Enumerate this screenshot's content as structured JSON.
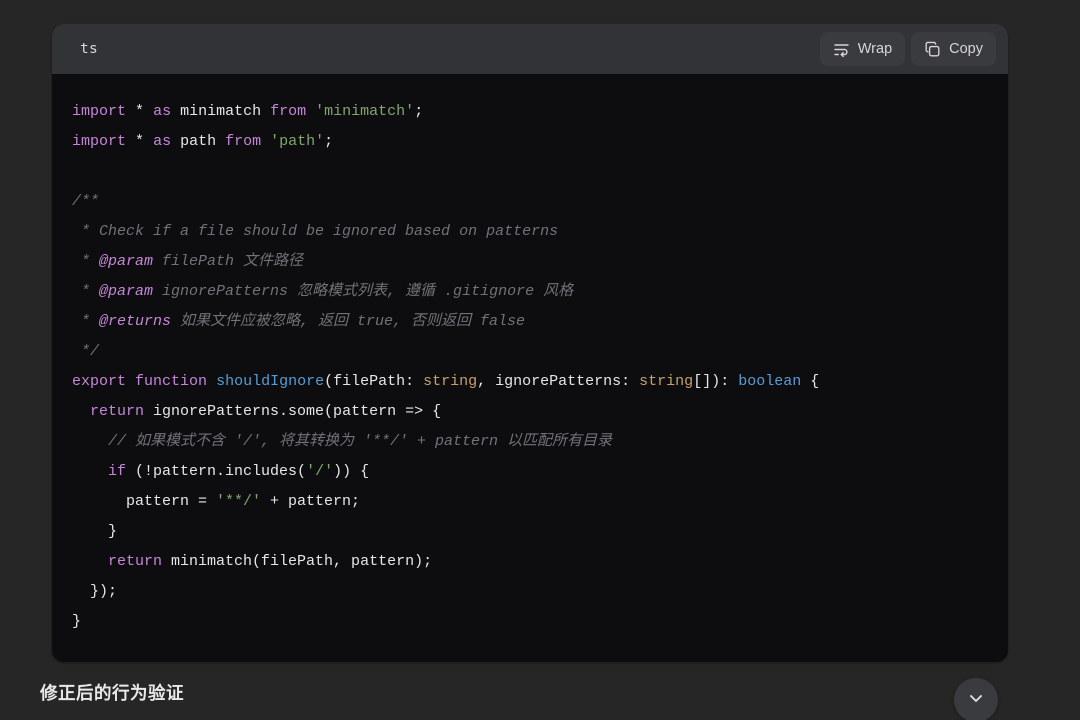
{
  "code_block": {
    "language_label": "ts",
    "actions": [
      {
        "label": "Wrap",
        "icon": "text-wrap-icon"
      },
      {
        "label": "Copy",
        "icon": "copy-icon"
      }
    ],
    "lines": [
      {
        "id": "l1",
        "text": "import * as minimatch from 'minimatch';"
      },
      {
        "id": "l2",
        "text": "import * as path from 'path';"
      },
      {
        "id": "l3",
        "text": ""
      },
      {
        "id": "l4",
        "text": "/**"
      },
      {
        "id": "l5",
        "text": " * Check if a file should be ignored based on patterns"
      },
      {
        "id": "l6",
        "text": " * @param filePath 文件路径"
      },
      {
        "id": "l7",
        "text": " * @param ignorePatterns 忽略模式列表, 遵循 .gitignore 风格"
      },
      {
        "id": "l8",
        "text": " * @returns 如果文件应被忽略, 返回 true, 否则返回 false"
      },
      {
        "id": "l9",
        "text": " */"
      },
      {
        "id": "l10",
        "text": "export function shouldIgnore(filePath: string, ignorePatterns: string[]): boolean {"
      },
      {
        "id": "l11",
        "text": "  return ignorePatterns.some(pattern => {"
      },
      {
        "id": "l12",
        "text": "    // 如果模式不含 '/', 将其转换为 '**/' + pattern 以匹配所有目录"
      },
      {
        "id": "l13",
        "text": "    if (!pattern.includes('/')) {"
      },
      {
        "id": "l14",
        "text": "      pattern = '**/' + pattern;"
      },
      {
        "id": "l15",
        "text": "    }"
      },
      {
        "id": "l16",
        "text": "    return minimatch(filePath, pattern);"
      },
      {
        "id": "l17",
        "text": "  });"
      },
      {
        "id": "l18",
        "text": "}"
      }
    ]
  },
  "bottom": {
    "heading": "修正后的行为验证",
    "scroll_button_icon": "chevron-down-icon"
  },
  "colors": {
    "page_background": "#262626",
    "code_background": "#0d0d0f",
    "code_header_background": "#323336",
    "keyword": "#c586d8",
    "string": "#7fa86a",
    "comment": "#6f7278",
    "function": "#569cd6",
    "type": "#c5a06a",
    "plain_text": "#e6e6e6",
    "button_background": "#3a3b3e"
  }
}
